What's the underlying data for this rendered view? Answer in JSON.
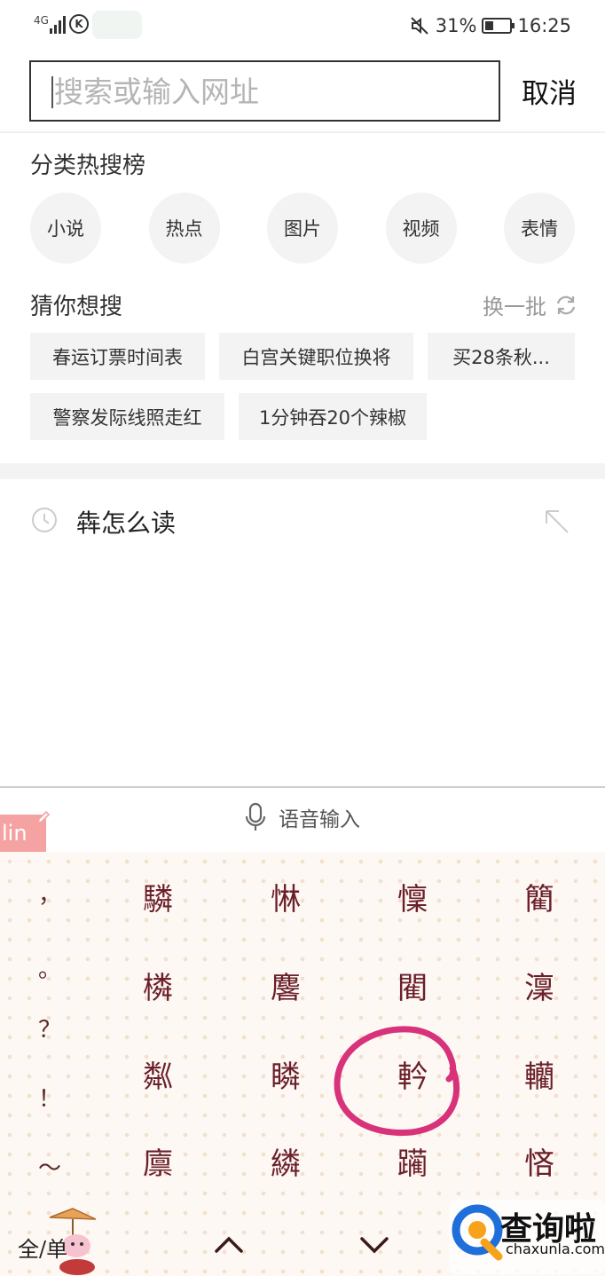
{
  "status_bar": {
    "network": "4G",
    "battery": "31%",
    "battery_level": 0.31,
    "time": "16:25"
  },
  "search": {
    "placeholder": "搜索或输入网址",
    "cancel_label": "取消"
  },
  "categories": {
    "title": "分类热搜榜",
    "items": [
      "小说",
      "热点",
      "图片",
      "视频",
      "表情"
    ]
  },
  "guess": {
    "title": "猜你想搜",
    "refresh_label": "换一批",
    "row1": [
      "春运订票时间表",
      "白宫关键职位换将",
      "买28条秋..."
    ],
    "row2": [
      "警察发际线照走红",
      "1分钟吞20个辣椒"
    ]
  },
  "history": {
    "items": [
      "犇怎么读"
    ]
  },
  "keyboard": {
    "voice_label": "语音输入",
    "pinyin": "lin",
    "punctuation": [
      "，",
      "。",
      "？",
      "！",
      "～"
    ],
    "candidates": [
      [
        "驎",
        "惏",
        "懍",
        "䉮"
      ],
      [
        "橉",
        "麐",
        "閵",
        "澟"
      ],
      [
        "粼",
        "瞵",
        "軡",
        "轥"
      ],
      [
        "廪",
        "繗",
        "躏",
        "悋"
      ]
    ],
    "skin_label": "全/单",
    "up_icon": "chevron-up-icon",
    "down_icon": "chevron-down-icon"
  },
  "watermark": {
    "text": "查询啦",
    "sub": "chaxunla.com",
    "accent": "#1e6fd9"
  }
}
